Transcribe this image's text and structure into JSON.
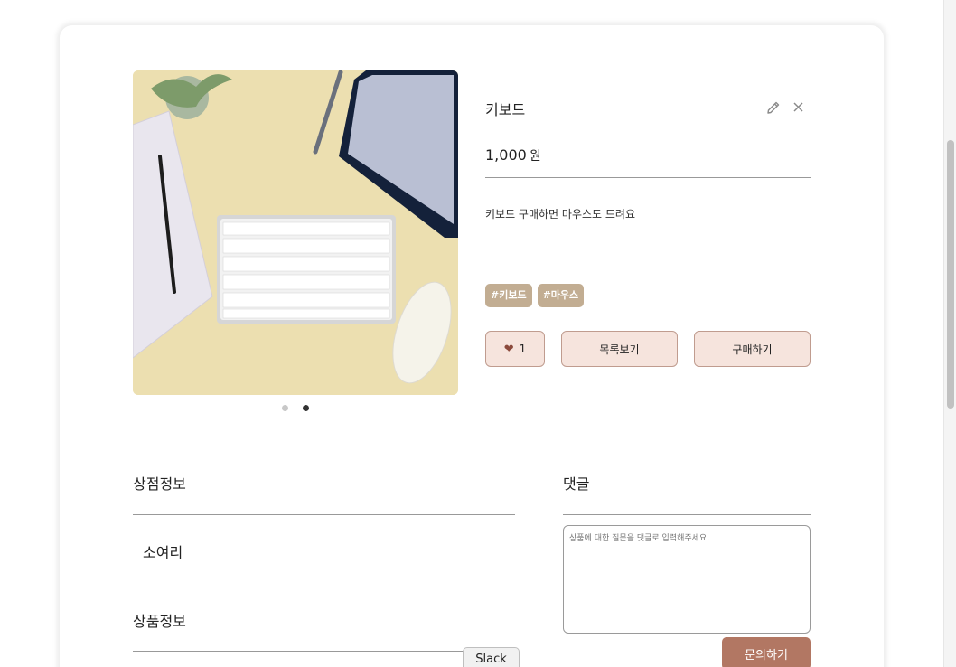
{
  "product": {
    "title": "키보드",
    "price": "1,000",
    "price_unit": "원",
    "description": "키보드 구매하면 마우스도 드려요",
    "tags": [
      "#키보드",
      "#마우스"
    ],
    "likes": "1"
  },
  "actions": {
    "list_label": "목록보기",
    "buy_label": "구매하기"
  },
  "store": {
    "section_title": "상점정보",
    "name": "소여리",
    "product_info_title": "상품정보"
  },
  "comments": {
    "section_title": "댓글",
    "placeholder": "상품에 대한 질문을 댓글로 입력해주세요.",
    "submit_label": "문의하기"
  },
  "floating": {
    "slack_label": "Slack"
  },
  "carousel": {
    "total": 2,
    "active_index": 1
  },
  "colors": {
    "tag_bg": "#c2ad92",
    "button_bg": "#f6e4dd",
    "button_border": "#c09c8f",
    "heart": "#8b4a3c",
    "inquiry_bg": "#b27763"
  },
  "icons": {
    "edit": "pencil-icon",
    "delete": "close-icon",
    "like": "heart-icon"
  }
}
